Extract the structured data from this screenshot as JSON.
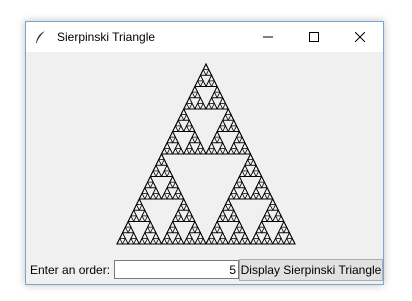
{
  "window": {
    "title": "Sierpinski Triangle",
    "icon": "feather-icon",
    "controls": [
      "minimize-icon",
      "maximize-icon",
      "close-icon"
    ]
  },
  "canvas": {
    "shape": "sierpinski-triangle",
    "order": 5,
    "stroke_color": "#000000",
    "background": "#f0f0f0"
  },
  "form": {
    "label": "Enter an order:",
    "order_value": "5",
    "button_label": "Display Sierpinski Triangle"
  }
}
